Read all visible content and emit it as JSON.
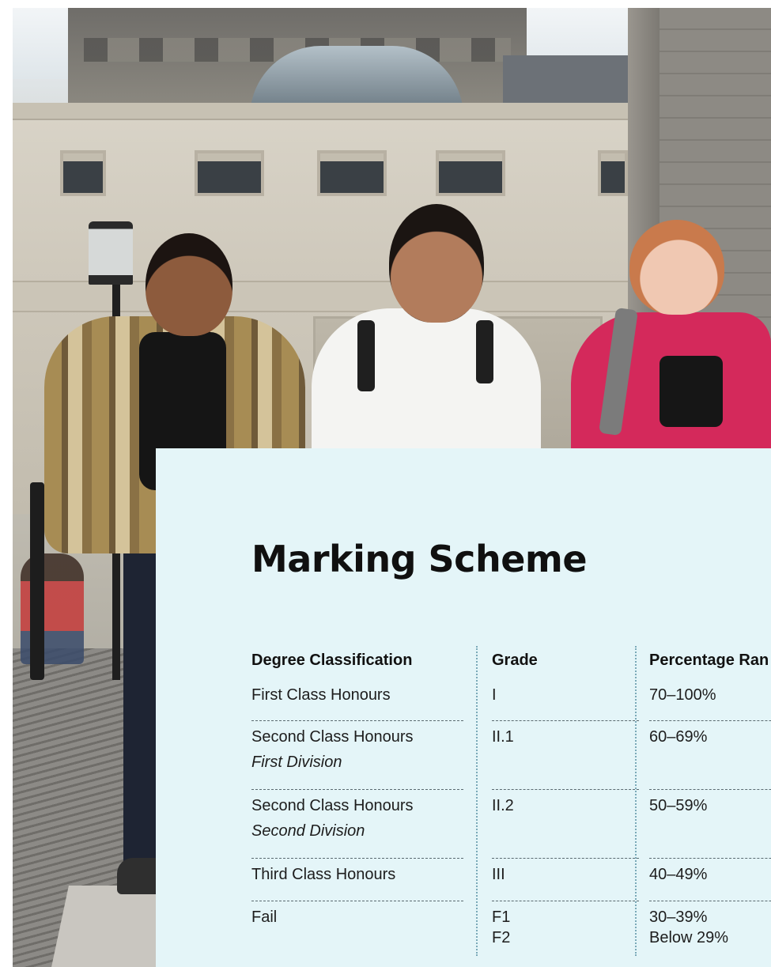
{
  "card": {
    "title": "Marking Scheme",
    "headers": {
      "classification": "Degree Classification",
      "grade": "Grade",
      "percentage": "Percentage Ran"
    },
    "rows": [
      {
        "classification": "First Class Honours",
        "sub": "",
        "grade": [
          "I"
        ],
        "percentage": [
          "70–100%"
        ]
      },
      {
        "classification": "Second Class Honours",
        "sub": "First Division",
        "grade": [
          "II.1"
        ],
        "percentage": [
          "60–69%"
        ]
      },
      {
        "classification": "Second Class Honours",
        "sub": "Second Division",
        "grade": [
          "II.2"
        ],
        "percentage": [
          "50–59%"
        ]
      },
      {
        "classification": "Third Class Honours",
        "sub": "",
        "grade": [
          "III"
        ],
        "percentage": [
          "40–49%"
        ]
      },
      {
        "classification": "Fail",
        "sub": "",
        "grade": [
          "F1",
          "F2"
        ],
        "percentage": [
          "30–39%",
          "Below 29%"
        ]
      }
    ]
  },
  "colors": {
    "card_background": "#e4f5f8",
    "divider": "#7aa9b8"
  }
}
